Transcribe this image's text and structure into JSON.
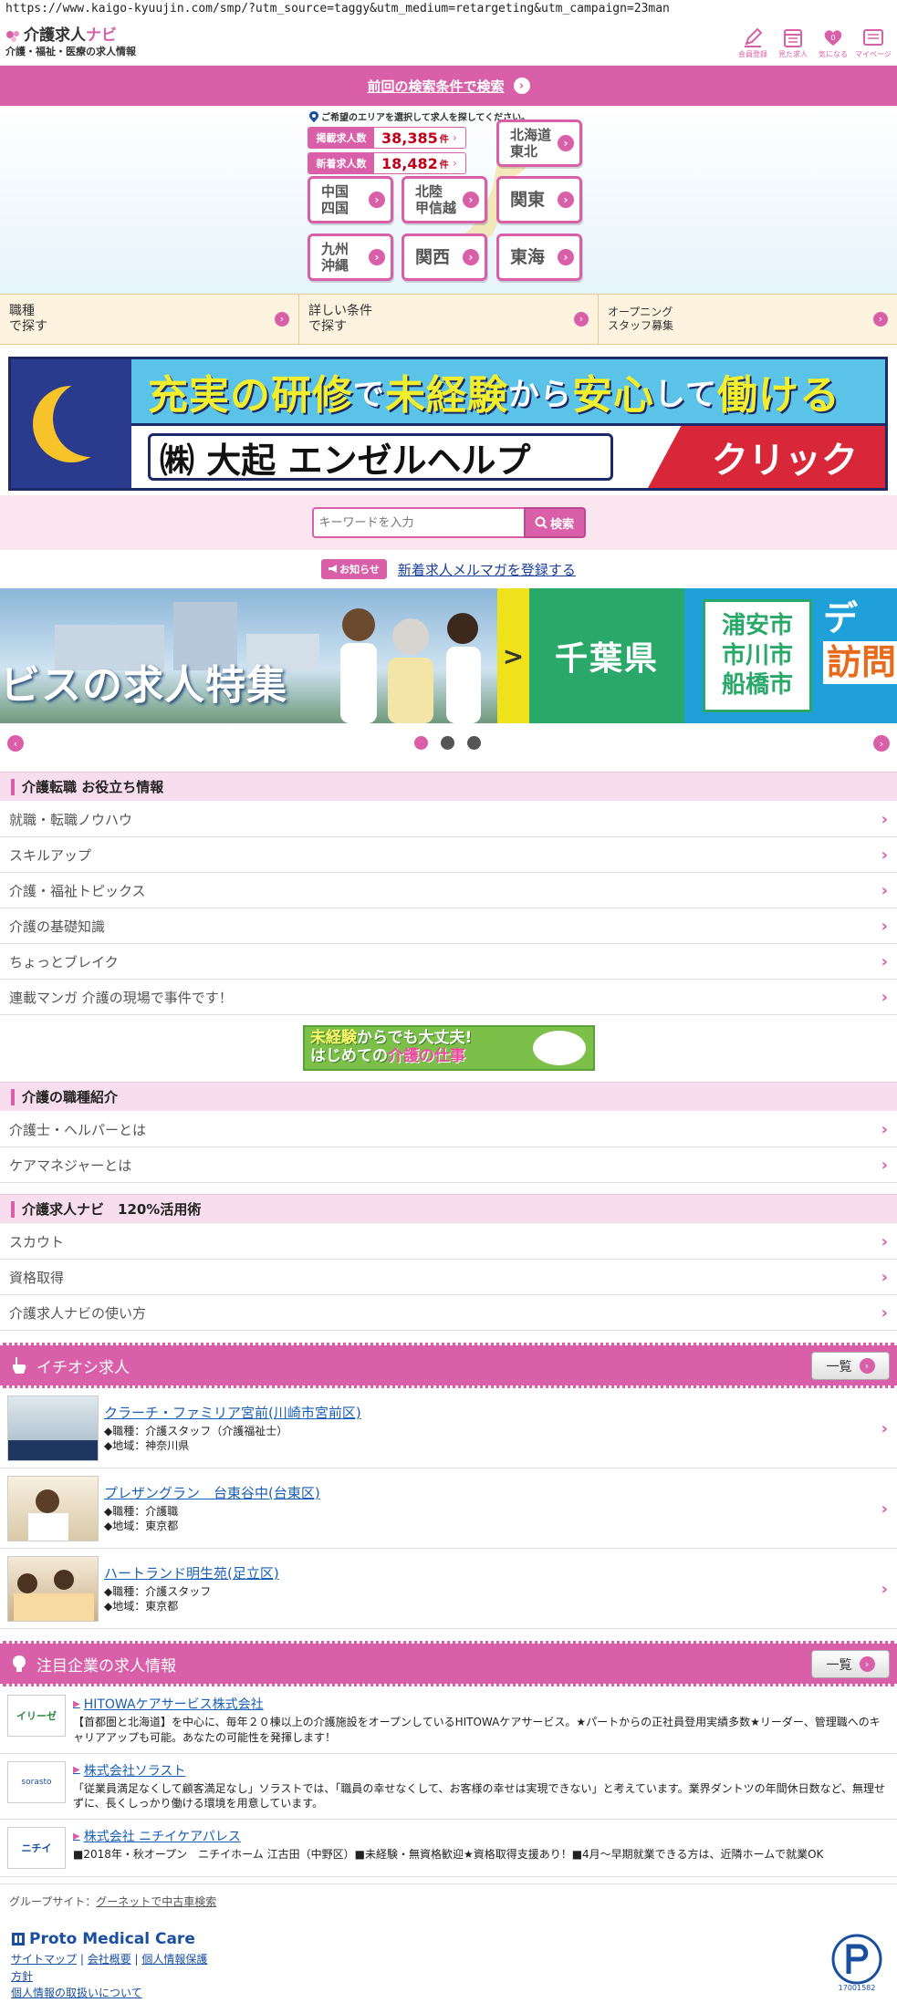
{
  "url": "https://www.kaigo-kyuujin.com/smp/?utm_source=taggy&utm_medium=retargeting&utm_campaign=23man",
  "header": {
    "logo_title_a": "介護求人",
    "logo_title_b": "ナビ",
    "logo_sub": "介護・福祉・医療の求人情報",
    "icons": [
      {
        "label": "会員登録",
        "icon": "pencil-icon"
      },
      {
        "label": "見た求人",
        "icon": "calendar-icon"
      },
      {
        "label": "気になる",
        "icon": "heart-icon"
      },
      {
        "label": "マイページ",
        "icon": "mypage-icon"
      }
    ]
  },
  "prev_search": "前回の検索条件で検索",
  "area": {
    "note": "ご希望のエリアを選択して求人を探してください。",
    "stats": [
      {
        "label": "掲載求人数",
        "value": "38,385",
        "unit": "件"
      },
      {
        "label": "新着求人数",
        "value": "18,482",
        "unit": "件"
      }
    ],
    "regions": [
      "北海道 東北",
      "中国 四国",
      "北陸 甲信越",
      "関東",
      "九州 沖縄",
      "関西",
      "東海"
    ],
    "r_hokkaido_1": "北海道",
    "r_hokkaido_2": "東北",
    "r_chugoku_1": "中国",
    "r_chugoku_2": "四国",
    "r_hokuriku_1": "北陸",
    "r_hokuriku_2": "甲信越",
    "r_kanto": "関東",
    "r_kyushu_1": "九州",
    "r_kyushu_2": "沖縄",
    "r_kansai": "関西",
    "r_tokai": "東海"
  },
  "tabs": {
    "t1_a": "職種",
    "t1_b": "で探す",
    "t2_a": "詳しい条件",
    "t2_b": "で探す",
    "t3_a": "オープニング",
    "t3_b": "スタッフ募集"
  },
  "ad": {
    "line1_a": "充実の研修",
    "line1_b": "で",
    "line1_c": "未経験",
    "line1_d": "から",
    "line1_e": "安心",
    "line1_f": "して",
    "line1_g": "働ける",
    "company": "㈱ 大起 エンゼルヘルプ",
    "click": "クリック"
  },
  "search": {
    "placeholder": "キーワードを入力",
    "button": "検索"
  },
  "notice": {
    "badge": "お知らせ",
    "link": "新着求人メルマガを登録する"
  },
  "carousel": {
    "slide1_text": "ビスの求人特集",
    "arrow": ">",
    "chiba": "千葉県",
    "cities": [
      "浦安市",
      "市川市",
      "船橋市"
    ],
    "slide2_a": "デ",
    "slide2_b": "訪問"
  },
  "useful": {
    "title": "介護転職 お役立ち情報",
    "items": [
      "就職・転職ノウハウ",
      "スキルアップ",
      "介護・福祉トピックス",
      "介護の基礎知識",
      "ちょっとブレイク",
      "連載マンガ 介護の現場で事件です！"
    ]
  },
  "mini_banner": {
    "a": "未経験",
    "b": "からでも大丈夫!",
    "c": "はじめての",
    "d": "介護の仕事"
  },
  "jobtypes": {
    "title": "介護の職種紹介",
    "items": [
      "介護士・ヘルパーとは",
      "ケアマネジャーとは"
    ]
  },
  "navi120": {
    "title": "介護求人ナビ　120%活用術",
    "items": [
      "スカウト",
      "資格取得",
      "介護求人ナビの使い方"
    ]
  },
  "pickup": {
    "title": "イチオシ求人",
    "list_button": "一覧",
    "jobs": [
      {
        "title": "クラーチ・ファミリア宮前(川崎市宮前区)",
        "job": "◆職種：介護スタッフ（介護福祉士）",
        "area": "◆地域：神奈川県"
      },
      {
        "title": "プレザングラン　台東谷中(台東区)",
        "job": "◆職種：介護職",
        "area": "◆地域：東京都"
      },
      {
        "title": "ハートランド明生苑(足立区)",
        "job": "◆職種：介護スタッフ",
        "area": "◆地域：東京都"
      }
    ]
  },
  "companies": {
    "title": "注目企業の求人情報",
    "list_button": "一覧",
    "items": [
      {
        "logo": "イリーゼ",
        "name": "HITOWAケアサービス株式会社",
        "desc": "【首都圏と北海道】を中心に、毎年２０棟以上の介護施設をオープンしているHITOWAケアサービス。★パートからの正社員登用実績多数★リーダー、管理職へのキャリアアップも可能。あなたの可能性を発揮します！"
      },
      {
        "logo": "sorasto",
        "name": "株式会社ソラスト",
        "desc": "「従業員満足なくして顧客満足なし」ソラストでは、「職員の幸せなくして、お客様の幸せは実現できない」と考えています。業界ダントツの年間休日数など、無理せずに、長くしっかり働ける環境を用意しています。"
      },
      {
        "logo": "ニチイ",
        "name": "株式会社 ニチイケアパレス",
        "desc": "■2018年・秋オープン　ニチイホーム 江古田（中野区）■未経験・無資格歓迎★資格取得支援あり！■4月～早期就業できる方は、近隣ホームで就業OK"
      }
    ]
  },
  "footer": {
    "group_label": "グループサイト：",
    "group_link": "グーネットで中古車検索",
    "brand": "Proto Medical Care",
    "links_line1": [
      "サイトマップ",
      "会社概要",
      "個人情報保護"
    ],
    "links_line2": "方針",
    "links_line3": "個人情報の取扱いについて",
    "pmark_number": "17001582"
  },
  "colors": {
    "pink": "#d95fa8",
    "link": "#1a5fb5",
    "red": "#c0001a"
  }
}
